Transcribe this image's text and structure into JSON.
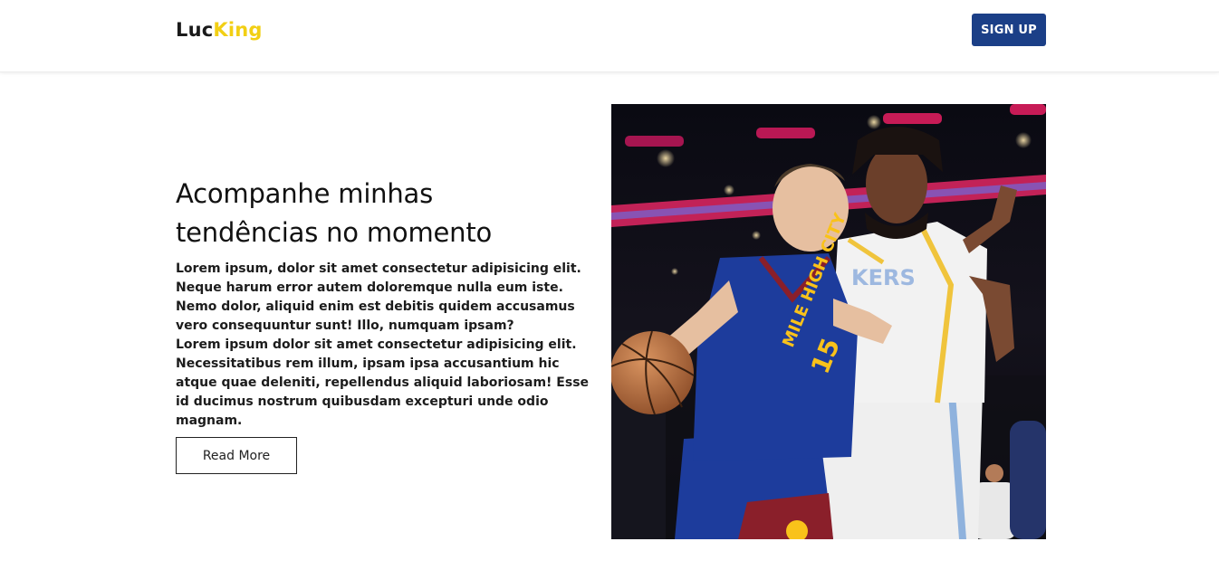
{
  "header": {
    "logo": {
      "part_a": "Luc",
      "part_b": "King"
    },
    "signup_label": "SIGN UP"
  },
  "hero": {
    "headline": "Acompanhe minhas tendências no momento",
    "paragraphs": [
      "Lorem ipsum, dolor sit amet consectetur adipisicing elit. Neque harum error autem doloremque nulla eum iste. Nemo dolor, aliquid enim est debitis quidem accusamus vero consequuntur sunt! Illo, numquam ipsam?",
      "Lorem ipsum dolor sit amet consectetur adipisicing elit. Necessitatibus rem illum, ipsam ipsa accusantium hic atque quae deleniti, repellendus aliquid laboriosam! Esse id ducimus nostrum quibusdam excepturi unde odio magnam."
    ],
    "read_more_label": "Read More",
    "photo": {
      "left_jersey_text": "MILE HIGH CITY",
      "left_jersey_number": "15",
      "right_jersey_text": "KERS"
    }
  },
  "colors": {
    "logo_dark": "#1a1a1a",
    "logo_accent": "#f2cf14",
    "signup_bg": "#1b3f87",
    "nuggets_blue": "#1d3c9c",
    "nuggets_gold": "#f9c21a",
    "nuggets_red": "#8a1f2a",
    "lakers_white": "#f2f2f2"
  }
}
